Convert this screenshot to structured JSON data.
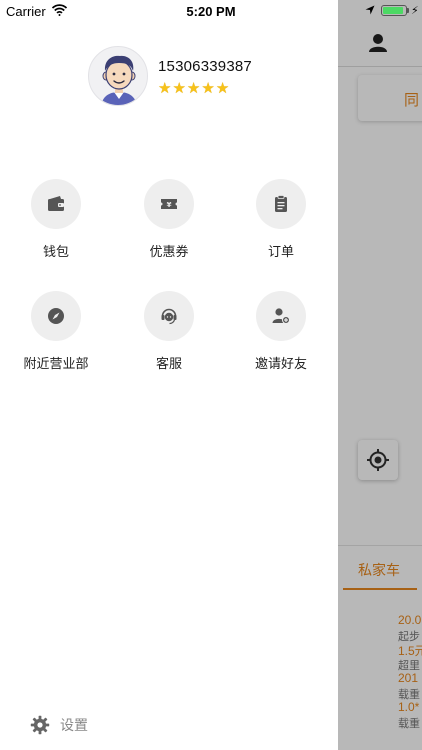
{
  "status_bar": {
    "carrier": "Carrier",
    "time": "5:20 PM",
    "battery_level": 0.9,
    "battery_color": "#4cd964"
  },
  "background_app": {
    "card_text": "同",
    "tab_label": "私家车",
    "accent_color": "#e8871e",
    "price_lines": [
      {
        "text": "20.0",
        "style": "orange"
      },
      {
        "text": "起步",
        "style": "gray"
      },
      {
        "text": "1.5元",
        "style": "orange"
      },
      {
        "text": "超里",
        "style": "gray"
      },
      {
        "text": "201",
        "style": "orange"
      },
      {
        "text": "载重",
        "style": "gray"
      },
      {
        "text": "1.0*",
        "style": "orange"
      },
      {
        "text": "载重",
        "style": "gray"
      }
    ]
  },
  "profile": {
    "phone": "15306339387",
    "rating": 5,
    "star_color": "#f7c21a"
  },
  "menu": {
    "items": [
      {
        "label": "钱包",
        "icon": "wallet-icon"
      },
      {
        "label": "优惠券",
        "icon": "coupon-icon"
      },
      {
        "label": "订单",
        "icon": "order-icon"
      },
      {
        "label": "附近营业部",
        "icon": "compass-icon"
      },
      {
        "label": "客服",
        "icon": "customer-service-icon"
      },
      {
        "label": "邀请好友",
        "icon": "invite-friend-icon"
      }
    ]
  },
  "footer": {
    "settings_label": "设置",
    "icon": "gear-icon"
  }
}
